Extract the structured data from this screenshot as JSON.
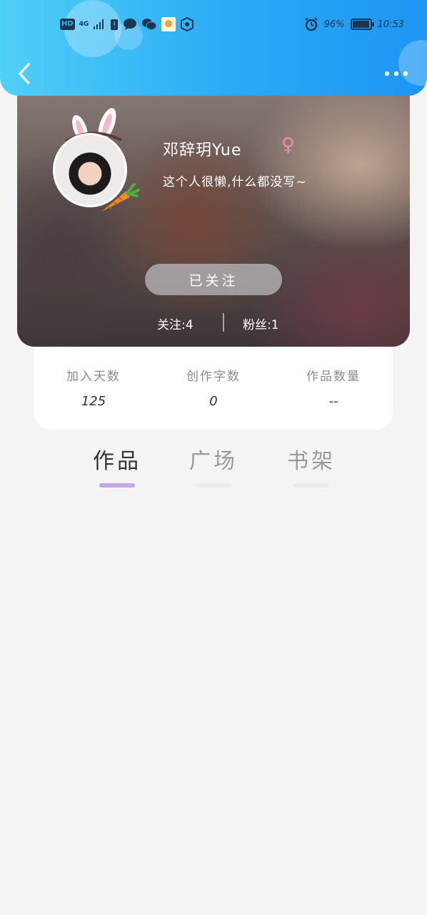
{
  "status_bar": {
    "left_icons": [
      "hd-badge",
      "4g-signal-icon",
      "battery-alert-icon",
      "chat-bubble-icon",
      "wechat-icon",
      "app-icon",
      "shield-app-icon"
    ],
    "hd_label": "HD",
    "network_label": "4G",
    "alarm_icon": "alarm-icon",
    "battery_percent": "96%",
    "battery_level": 0.96,
    "time": "10:53"
  },
  "header": {
    "back_icon": "chevron-left-icon",
    "more_icon": "more-dots-icon",
    "colors": {
      "start": "#4fd0f7",
      "end": "#1d96f4"
    }
  },
  "profile": {
    "nickname": "邓辞玥Yue",
    "gender_symbol": "♀",
    "bio": "这个人很懒,什么都没写~",
    "follow_button_label": "已关注",
    "following_text": "关注:4",
    "fans_text": "粉丝:1",
    "avatar_decor": [
      "bunny-ears-icon",
      "carrot-icon"
    ]
  },
  "info": {
    "items": [
      {
        "label": "加入天数",
        "value": "125"
      },
      {
        "label": "创作字数",
        "value": "0"
      },
      {
        "label": "作品数量",
        "value": "--"
      }
    ]
  },
  "tabs": {
    "items": [
      {
        "label": "作品",
        "active": true
      },
      {
        "label": "广场",
        "active": false
      },
      {
        "label": "书架",
        "active": false
      }
    ],
    "active_color": "#c7a7ea"
  }
}
